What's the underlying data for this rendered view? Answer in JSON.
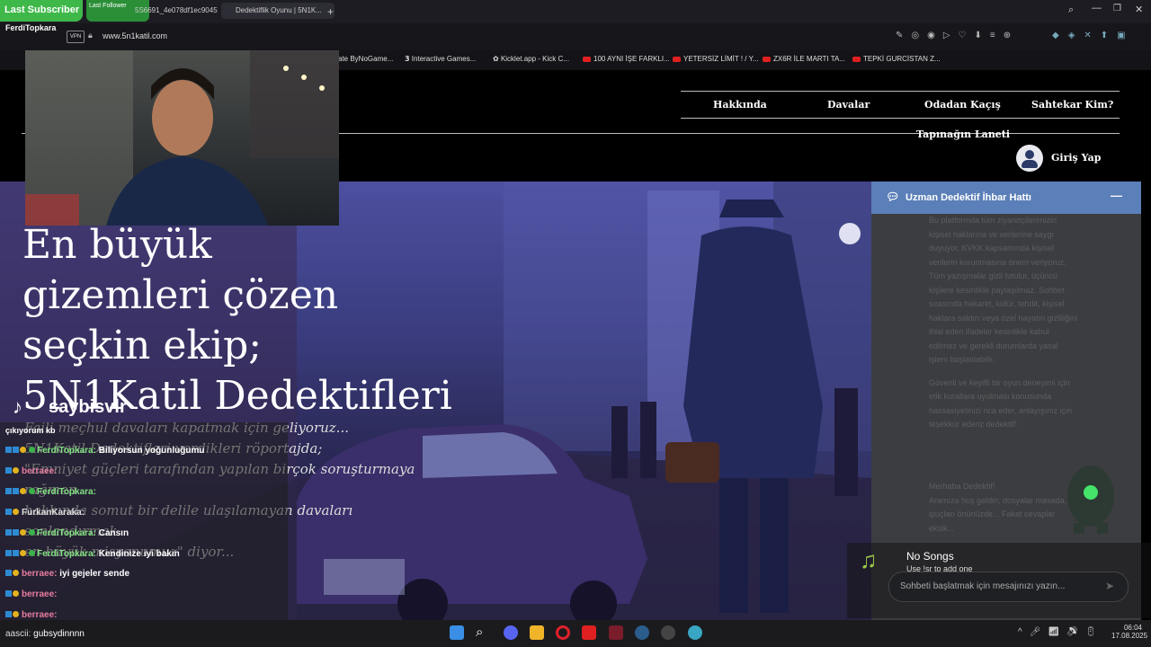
{
  "overlay": {
    "last_subscriber": "Last Subscriber",
    "last_follower": "Last Follower",
    "webcam_name": "FerdiTopkara",
    "tiktok_handle": "saybisvlr",
    "music": {
      "title": "No Songs",
      "hint": "Use !sr to add one"
    }
  },
  "browser": {
    "tabs": [
      {
        "label": "5S6691_4e078df1ec9045..."
      },
      {
        "label": "Dedektiflik Oyunu | 5N1K..."
      }
    ],
    "address": "www.5n1katil.com",
    "vpn_label": "VPN",
    "bookmarks": [
      "ate ByNoGame...",
      "Interactive Games...",
      "Kicklet.app - Kick C...",
      "100 AYNI İŞE FARKLI...",
      "YETERSİZ LİMİT ! / Y...",
      "ZX6R İLE MARTI TA...",
      "TEPKİ GURCİSTAN Z..."
    ]
  },
  "site": {
    "nav": {
      "about": "Hakkında",
      "cases": "Davalar",
      "escape_room": "Odadan Kaçış",
      "impostor": "Sahtekar Kim?",
      "temple": "Tapınağın Laneti",
      "login": "Giriş Yap"
    },
    "hero": {
      "headline_lines": [
        "En büyük",
        "gizemleri çözen",
        "seçkin ekip;",
        "5N1Katil Dedektifleri"
      ],
      "sub_lines": [
        "Faili meçhul davaları kapatmak için geliyoruz...",
        "5N1Katil Dedektifleri verdikleri röportajda;",
        "\"Emniyet güçleri tarafından yapılan birçok soruşturmaya rağmen",
        "hakkında somut bir delile ulaşılamayan davaları sonlandırmak",
        "en büyük misyonumuz\" diyor..."
      ]
    },
    "chat_widget": {
      "title": "Uzman Dedektif İhbar Hattı",
      "minimize": "—",
      "privacy_paragraph_1": [
        "Bu platformda tüm ziyaretçilerimizin",
        "kişisel haklarına ve verilerine saygı",
        "duyuyor, KVKK kapsamında kişisel",
        "verilerin korunmasına önem veriyoruz.",
        "Tüm yazışmalar gizli tutulur, üçüncü",
        "kişilere kesinlikle paylaşılmaz. Sohbet",
        "sırasında hakaret, küfür, tehdit, kişisel",
        "haklara saldırı veya özel hayatın gizliliğini",
        "ihlal eden ifadeler kesinlikle kabul",
        "edilmez ve gerekli durumlarda yasal",
        "işlem başlatılabilir."
      ],
      "privacy_paragraph_2": [
        "Güvenli ve keyifli bir oyun deneyimi için",
        "etik kurallara uyulması konusunda",
        "hassasiyetinizi rica eder, anlayışınız için",
        "teşekkür ederiz dedektif!"
      ],
      "greeting": [
        "Merhaba Dedektif!",
        "Aramıza hoş geldin, dosyalar masada,",
        "ipuçları önünüzde... Fakat cevaplar",
        "eksik..."
      ],
      "input_placeholder": "Sohbeti başlatmak için mesajınızı yazın..."
    }
  },
  "stream_chat": {
    "notice": "çıkıyorum kb",
    "messages": [
      {
        "user": "FerdiTopkara:",
        "text": "Biliyorsun yoğunluğumu"
      },
      {
        "user": "berraee:",
        "text": ""
      },
      {
        "user": "FerdiTopkara:",
        "text": ""
      },
      {
        "user": "FurkanKaraka:",
        "text": ""
      },
      {
        "user": "FerdiTopkara:",
        "text": "Cansın"
      },
      {
        "user": "FerdiTopkara:",
        "text": "Kendinize iyi bakın"
      },
      {
        "user": "berraee:",
        "text": "iyi gejeler sende"
      },
      {
        "user": "berraee:",
        "text": ""
      },
      {
        "user": "berraee:",
        "text": ""
      }
    ],
    "input_user": "aascii:",
    "input_text": "gubsydinnnn"
  },
  "taskbar": {
    "time": "06:04",
    "date": "17.08.2025"
  },
  "colors": {
    "chat_header": "#5b7fb8",
    "site_bg": "#000000",
    "chrome_bg": "#1c1c22"
  }
}
